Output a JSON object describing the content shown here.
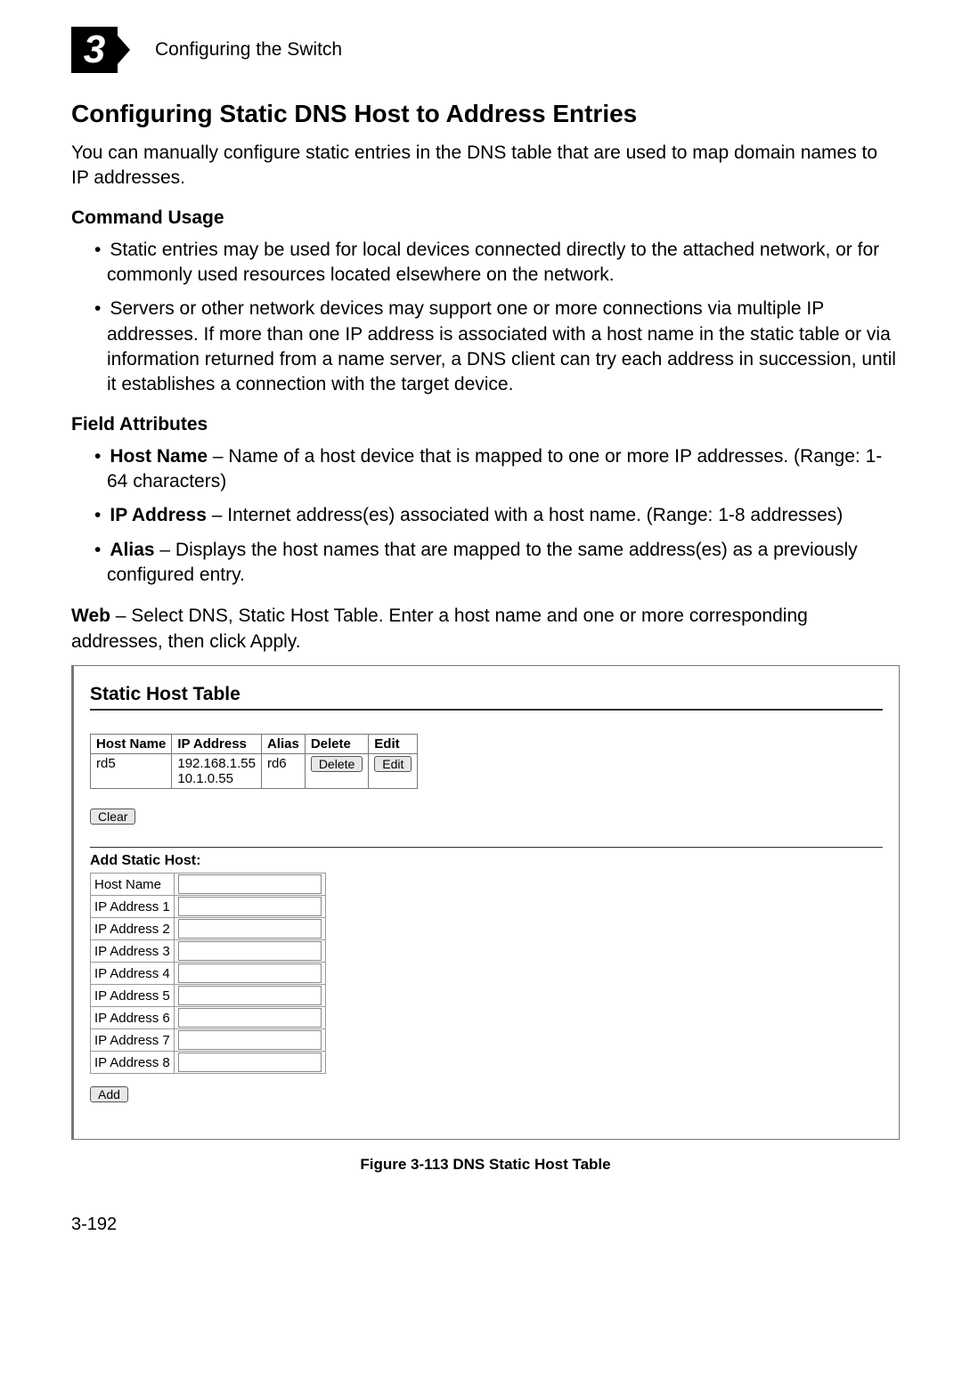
{
  "chapter_number": "3",
  "chapter_title": "Configuring the Switch",
  "section_heading": "Configuring Static DNS Host to Address Entries",
  "intro": "You can manually configure static entries in the DNS table that are used to map domain names to IP addresses.",
  "command_usage_head": "Command Usage",
  "command_usage": [
    "Static entries may be used for local devices connected directly to the attached network, or for commonly used resources located elsewhere on the network.",
    "Servers or other network devices may support one or more connections via multiple IP addresses. If more than one IP address is associated with a host name in the static table or via information returned from a name server, a DNS client can try each address in succession, until it establishes a connection with the target device."
  ],
  "field_attr_head": "Field Attributes",
  "field_attrs": [
    {
      "term": "Host Name",
      "desc": " – Name of a host device that is mapped to one or more IP addresses. (Range: 1-64 characters)"
    },
    {
      "term": "IP Address",
      "desc": " – Internet address(es) associated with a host name. (Range: 1-8 addresses)"
    },
    {
      "term": "Alias",
      "desc": " – Displays the host names that are mapped to the same address(es) as a previously configured entry."
    }
  ],
  "web_bold": "Web",
  "web_text": " – Select DNS, Static Host Table. Enter a host name and one or more corresponding addresses, then click Apply.",
  "screenshot": {
    "title": "Static Host Table",
    "cols": [
      "Host Name",
      "IP Address",
      "Alias",
      "Delete",
      "Edit"
    ],
    "row": {
      "host": "rd5",
      "ips": "192.168.1.55\n10.1.0.55",
      "alias": "rd6",
      "delete_btn": "Delete",
      "edit_btn": "Edit"
    },
    "clear_btn": "Clear",
    "add_title": "Add Static Host:",
    "add_rows": [
      "Host Name",
      "IP Address 1",
      "IP Address 2",
      "IP Address 3",
      "IP Address 4",
      "IP Address 5",
      "IP Address 6",
      "IP Address 7",
      "IP Address 8"
    ],
    "add_btn": "Add"
  },
  "figure_caption": "Figure 3-113  DNS Static Host Table",
  "page_number": "3-192"
}
